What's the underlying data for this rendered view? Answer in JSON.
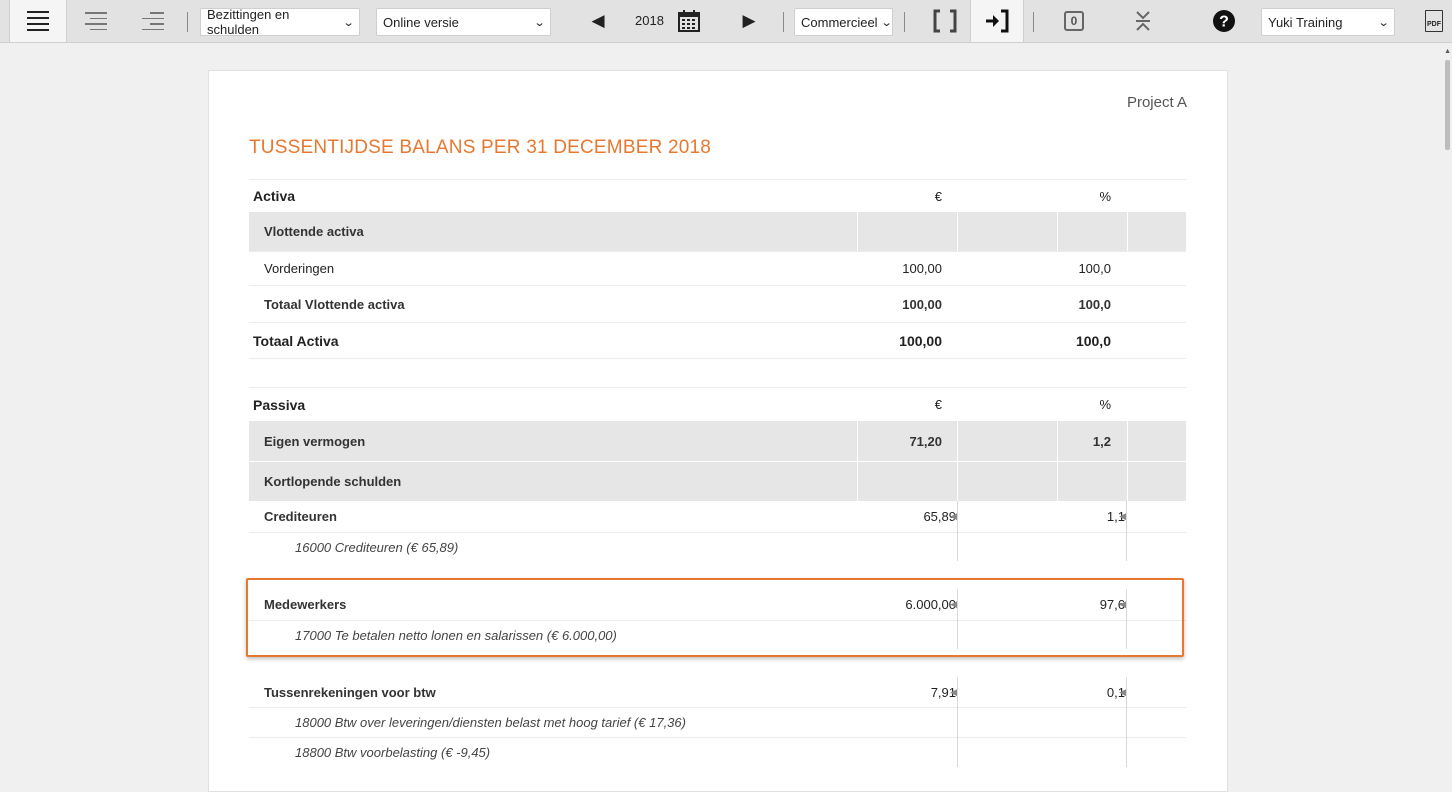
{
  "toolbar": {
    "report_select": "Bezittingen en schulden",
    "version_select": "Online versie",
    "year": "2018",
    "type_select": "Commercieel",
    "badge_count": "0",
    "company_select": "Yuki Training",
    "pdf_label": "PDF"
  },
  "report": {
    "project": "Project A",
    "title": "TUSSENTIJDSE BALANS PER 31 DECEMBER 2018",
    "activa": {
      "heading": "Activa",
      "currency_col": "€",
      "percent_col": "%",
      "group": "Vlottende activa",
      "rows": [
        {
          "label": "Vorderingen",
          "amount": "100,00",
          "percent": "100,0"
        }
      ],
      "subtotal": {
        "label": "Totaal Vlottende activa",
        "amount": "100,00",
        "percent": "100,0"
      },
      "total": {
        "label": "Totaal Activa",
        "amount": "100,00",
        "percent": "100,0"
      }
    },
    "passiva": {
      "heading": "Passiva",
      "currency_col": "€",
      "percent_col": "%",
      "equity": {
        "label": "Eigen vermogen",
        "amount": "71,20",
        "percent": "1,2"
      },
      "group": "Kortlopende schulden",
      "creditors": {
        "label": "Crediteuren",
        "amount": "65,89",
        "percent": "1,1",
        "detail": "16000 Crediteuren (€ 65,89)"
      },
      "employees": {
        "label": "Medewerkers",
        "amount": "6.000,00",
        "percent": "97,6",
        "detail": "17000 Te betalen netto lonen en salarissen (€ 6.000,00)"
      },
      "vat": {
        "label": "Tussenrekeningen voor btw",
        "amount": "7,91",
        "percent": "0,1",
        "details": [
          "18000 Btw over leveringen/diensten belast met hoog tarief (€ 17,36)",
          "18800 Btw voorbelasting (€ -9,45)"
        ]
      }
    }
  },
  "colors": {
    "accent": "#e8782f",
    "group_bg": "#e6e6e6",
    "toolbar_bg": "#e2e2e2"
  }
}
